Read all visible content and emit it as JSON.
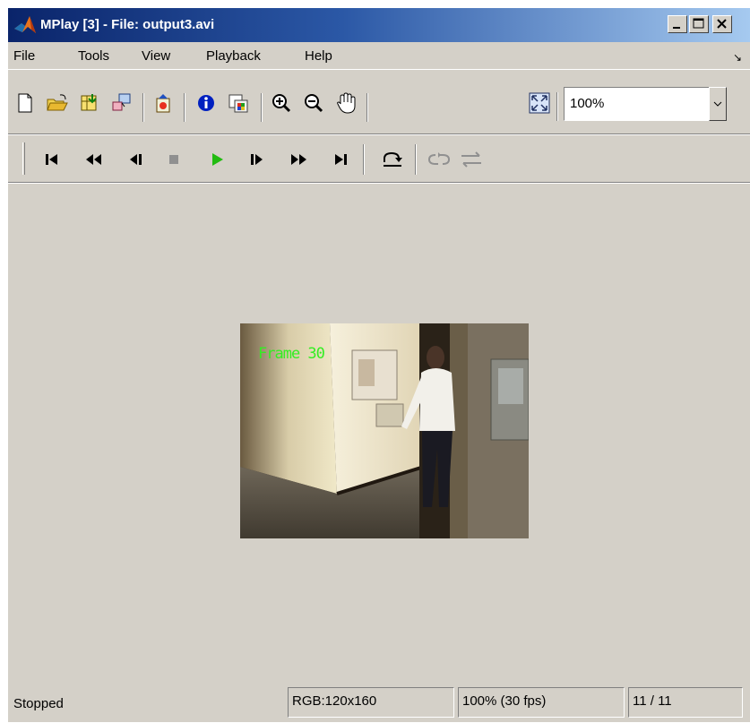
{
  "window": {
    "title": "MPlay [3] - File: output3.avi",
    "buttons": [
      "minimize",
      "maximize",
      "close"
    ]
  },
  "menu": {
    "items": [
      "File",
      "Tools",
      "View",
      "Playback",
      "Help"
    ]
  },
  "toolbar": {
    "zoom_value": "100%",
    "icons": [
      "new-icon",
      "open-icon",
      "import-icon",
      "connect-icon",
      "export-icon",
      "info-icon",
      "colormap-icon",
      "zoom-in-icon",
      "zoom-out-icon",
      "pan-hand-icon",
      "fit-to-view-icon"
    ]
  },
  "playback": {
    "icons": [
      "go-to-first-icon",
      "rewind-icon",
      "step-back-icon",
      "stop-icon",
      "play-icon",
      "step-forward-icon",
      "fast-forward-icon",
      "go-to-last-icon",
      "jump-to-icon",
      "loop-icon",
      "autoreverse-icon"
    ],
    "accent_play": "#22bb11"
  },
  "video": {
    "overlay_text": "Frame 30",
    "overlay_color": "#33ee22"
  },
  "status": {
    "state": "Stopped",
    "image_info": "RGB:120x160",
    "rate": "100% (30 fps)",
    "frame": "11 / 11"
  }
}
